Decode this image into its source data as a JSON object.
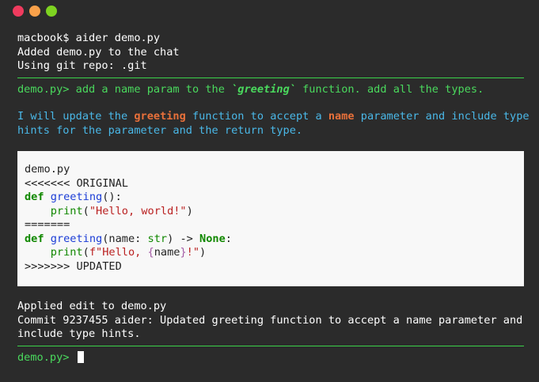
{
  "window": {
    "controls": [
      "close",
      "minimize",
      "zoom"
    ],
    "colors": {
      "close": "#ef3b5e",
      "minimize": "#f9a14a",
      "zoom": "#7ed321"
    }
  },
  "session": {
    "command": "macbook$ aider demo.py",
    "added": "Added demo.py to the chat",
    "repo": "Using git repo: .git"
  },
  "user_turn": {
    "prompt": "demo.py> ",
    "text_before": "add a name param to the ",
    "code_word": "`greeting`",
    "text_after": " function. add all the types."
  },
  "assistant": {
    "part1": "I will update the ",
    "word1": "greeting",
    "part2": " function to accept a ",
    "word2": "name",
    "part3": " parameter and include type",
    "line2": "hints for the parameter and the return type."
  },
  "code": {
    "filename": "demo.py",
    "original_marker": "<<<<<<< ORIGINAL",
    "def_kw": "def",
    "old_fn_name": "greeting",
    "old_fn_rest": "():",
    "old_print_indent": "    ",
    "print_name": "print",
    "old_print_arg": "\"Hello, world!\"",
    "divider": "=======",
    "new_fn_name": "greeting",
    "new_params_open": "(name: ",
    "type_str": "str",
    "arrow": ") -> ",
    "none_kw": "None",
    "colon": ":",
    "new_print_fstr_open": "f\"Hello, ",
    "new_print_interp_open": "{",
    "new_print_interp_name": "name",
    "new_print_interp_close": "}",
    "new_print_fstr_close": "!\"",
    "updated_marker": ">>>>>>> UPDATED"
  },
  "result": {
    "applied": "Applied edit to demo.py",
    "commit_line1": "Commit 9237455 aider: Updated greeting function to accept a name parameter and",
    "commit_line2": "include type hints."
  },
  "final_prompt": "demo.py> "
}
